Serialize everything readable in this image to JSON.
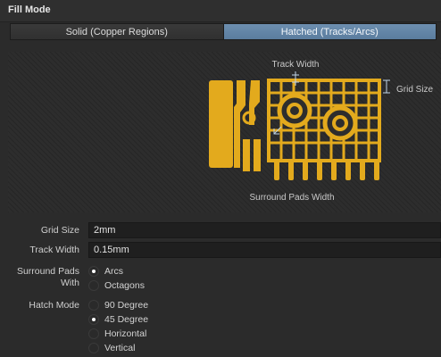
{
  "section_title": "Fill Mode",
  "fill_mode_tabs": [
    {
      "label": "Solid (Copper Regions)",
      "active": false
    },
    {
      "label": "Hatched (Tracks/Arcs)",
      "active": true
    }
  ],
  "preview": {
    "track_width_label": "Track Width",
    "grid_size_label": "Grid Size",
    "surround_pads_width_label": "Surround Pads Width",
    "copper_color": "#e3aa1d"
  },
  "fields": {
    "grid_size": {
      "label": "Grid Size",
      "value": "2mm"
    },
    "track_width": {
      "label": "Track Width",
      "value": "0.15mm"
    }
  },
  "surround_pads": {
    "label": "Surround Pads With",
    "options": [
      {
        "label": "Arcs",
        "checked": true
      },
      {
        "label": "Octagons",
        "checked": false
      }
    ]
  },
  "hatch_mode": {
    "label": "Hatch Mode",
    "options": [
      {
        "label": "90 Degree",
        "checked": false
      },
      {
        "label": "45 Degree",
        "checked": true
      },
      {
        "label": "Horizontal",
        "checked": false
      },
      {
        "label": "Vertical",
        "checked": false
      }
    ]
  }
}
